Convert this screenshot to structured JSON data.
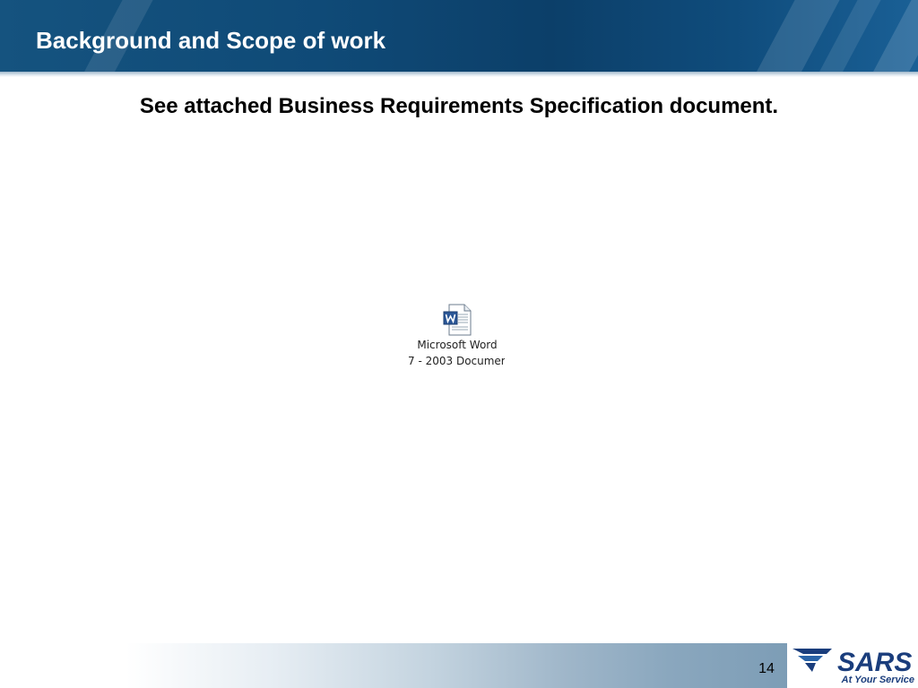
{
  "slide": {
    "title": "Background and Scope of work",
    "body": "See attached Business Requirements Specification document.",
    "page_number": "14"
  },
  "attachment": {
    "icon": "word-document-icon",
    "caption_line1": "Microsoft Word",
    "caption_line2": "7 - 2003 Documer"
  },
  "logo": {
    "name": "SARS",
    "tagline": "At Your Service"
  },
  "colors": {
    "header_blue": "#0f4a77",
    "logo_blue": "#1a3d7c",
    "footer_blue": "#7d9db6"
  }
}
